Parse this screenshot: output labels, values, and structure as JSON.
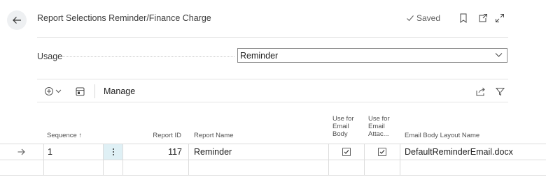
{
  "header": {
    "title": "Report Selections Reminder/Finance Charge",
    "saved_label": "Saved"
  },
  "usage": {
    "label": "Usage",
    "value": "Reminder"
  },
  "actions": {
    "manage_label": "Manage"
  },
  "table": {
    "columns": {
      "sequence": "Sequence",
      "sort_arrow": "↑",
      "report_id": "Report ID",
      "report_name": "Report Name",
      "use_email_body": [
        "Use for",
        "Email",
        "Body"
      ],
      "use_email_attach": [
        "Use for",
        "Email",
        "Attac..."
      ],
      "email_body_layout": "Email Body Layout Name"
    },
    "rows": [
      {
        "sequence": "1",
        "report_id": "117",
        "report_name": "Reminder",
        "use_email_body": true,
        "use_email_attach": true,
        "email_body_layout": "DefaultReminderEmail.docx"
      }
    ]
  },
  "colors": {
    "accent": "#0f6cbd",
    "selected_cell_bg": "#dff0f5",
    "border": "#dcdcdc"
  }
}
